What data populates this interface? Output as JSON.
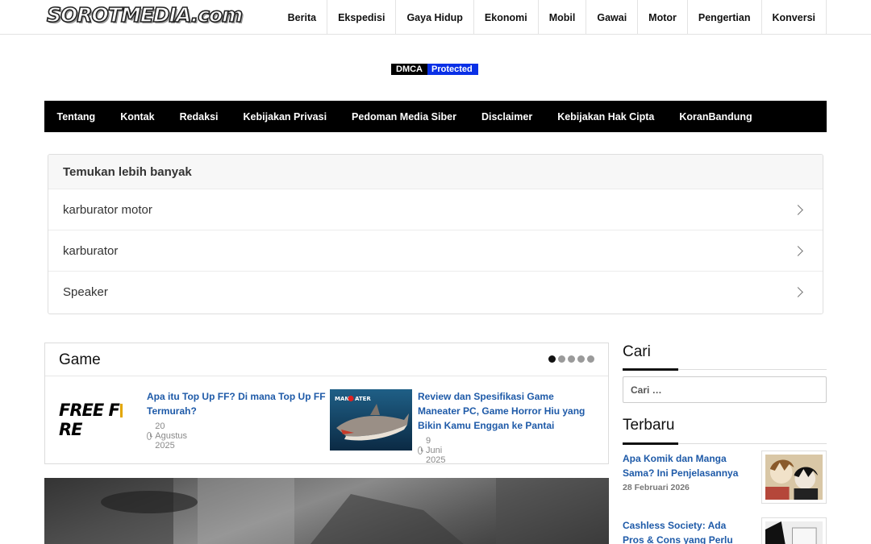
{
  "header": {
    "logo": "SOROTMEDIA.com",
    "nav": [
      "Berita",
      "Ekspedisi",
      "Gaya Hidup",
      "Ekonomi",
      "Mobil",
      "Gawai",
      "Motor",
      "Pengertian",
      "Konversi"
    ]
  },
  "dmca": {
    "left": "DMCA",
    "right": "Protected"
  },
  "menubar": [
    "Tentang",
    "Kontak",
    "Redaksi",
    "Kebijakan Privasi",
    "Pedoman Media Siber",
    "Disclaimer",
    "Kebijakan Hak Cipta",
    "KoranBandung"
  ],
  "related": {
    "title": "Temukan lebih banyak",
    "items": [
      "karburator motor",
      "karburator",
      "Speaker"
    ]
  },
  "game": {
    "title": "Game",
    "posts": [
      {
        "title": "Apa itu Top Up FF? Di mana Top Up FF Termurah?",
        "date": "20 Agustus 2025",
        "thumb_text": "FREE FIRE"
      },
      {
        "title": "Review dan Spesifikasi Game Maneater PC, Game Horror Hiu yang Bikin Kamu Enggan ke Pantai",
        "date": "9 Juni 2025",
        "thumb_text": "MANEATER"
      }
    ]
  },
  "sidebar": {
    "search_title": "Cari",
    "search_placeholder": "Cari …",
    "latest_title": "Terbaru",
    "latest": [
      {
        "title": "Apa Komik dan Manga Sama? Ini Penjelasannya",
        "date": "28 Februari 2026"
      },
      {
        "title": "Cashless Society: Ada Pros & Cons yang Perlu D…",
        "date": ""
      }
    ]
  },
  "colors": {
    "link": "#1e5aa8",
    "menubar": "#000000",
    "dmca_blue": "#0a30e6"
  }
}
